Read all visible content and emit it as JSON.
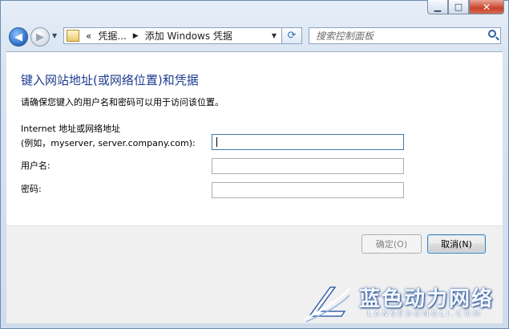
{
  "window": {
    "caption_buttons": {
      "minimize": "▁",
      "maximize": "□",
      "close": "✕"
    }
  },
  "nav": {
    "back_icon": "arrow-left-icon",
    "forward_icon": "arrow-right-icon",
    "back_glyph": "◀",
    "forward_glyph": "▶",
    "history_glyph": "▼"
  },
  "address_bar": {
    "overflow": "«",
    "crumbs": [
      "凭据...",
      "添加 Windows 凭据"
    ],
    "separator": "▶",
    "dropdown_glyph": "▼",
    "refresh_glyph": "⟳"
  },
  "search": {
    "placeholder": "搜索控制面板"
  },
  "content": {
    "heading": "键入网站地址(或网络位置)和凭据",
    "description": "请确保您键入的用户名和密码可以用于访问该位置。",
    "fields": {
      "address_label_line1": "Internet 地址或网络地址",
      "address_label_line2": "(例如，myserver, server.company.com):",
      "username_label": "用户名:",
      "password_label": "密码:",
      "address_value": "",
      "username_value": "",
      "password_value": ""
    }
  },
  "footer": {
    "ok_label": "确定(O)",
    "cancel_label": "取消(N)"
  },
  "watermark": {
    "text": "蓝色动力网络",
    "sub": "LANSEDONGLI.COM"
  },
  "colors": {
    "heading": "#1e3b8e",
    "frame": "#cfdcec",
    "close_button": "#c8432b"
  }
}
